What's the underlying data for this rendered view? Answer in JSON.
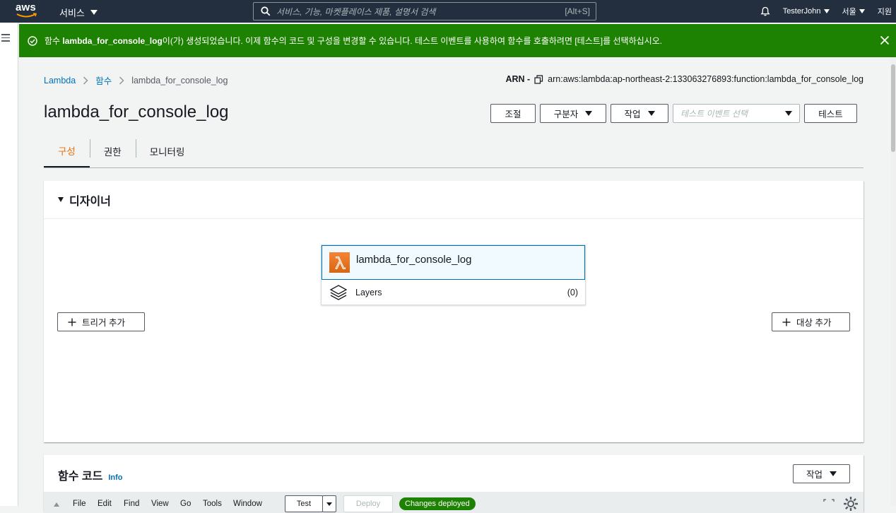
{
  "nav": {
    "logo": "aws",
    "services": "서비스",
    "search_placeholder": "서비스, 기능, 마켓플레이스 제품, 설명서 검색",
    "search_shortcut": "[Alt+S]",
    "user": "TesterJohn",
    "region": "서울",
    "support": "지원"
  },
  "flash": {
    "prefix": "함수 ",
    "function_name": "lambda_for_console_log",
    "suffix": "이(가) 생성되었습니다. 이제 함수의 코드 및 구성을 변경할 수 있습니다. 테스트 이벤트를 사용하여 함수를 호출하려면 [테스트]를 선택하십시오."
  },
  "breadcrumb": {
    "root": "Lambda",
    "section": "함수",
    "current": "lambda_for_console_log"
  },
  "arn": {
    "label": "ARN -",
    "value": "arn:aws:lambda:ap-northeast-2:133063276893:function:lambda_for_console_log"
  },
  "page_title": "lambda_for_console_log",
  "actions": {
    "throttle": "조절",
    "qualifiers": "구분자",
    "actions": "작업",
    "test_event_placeholder": "테스트 이벤트 선택",
    "test": "테스트"
  },
  "tabs": [
    "구성",
    "권한",
    "모니터링"
  ],
  "designer": {
    "heading": "디자이너",
    "function_name": "lambda_for_console_log",
    "layers_label": "Layers",
    "layers_count": "(0)",
    "add_trigger": "트리거 추가",
    "add_destination": "대상 추가"
  },
  "code": {
    "heading": "함수 코드",
    "info": "Info",
    "actions": "작업",
    "menus": [
      "File",
      "Edit",
      "Find",
      "View",
      "Go",
      "Tools",
      "Window"
    ],
    "test": "Test",
    "deploy": "Deploy",
    "status": "Changes deployed"
  },
  "colors": {
    "nav": "#232f3e",
    "success": "#1d8102",
    "link": "#0073bb",
    "active_tab": "#ec7211",
    "lambda_orange": "#d86613"
  }
}
